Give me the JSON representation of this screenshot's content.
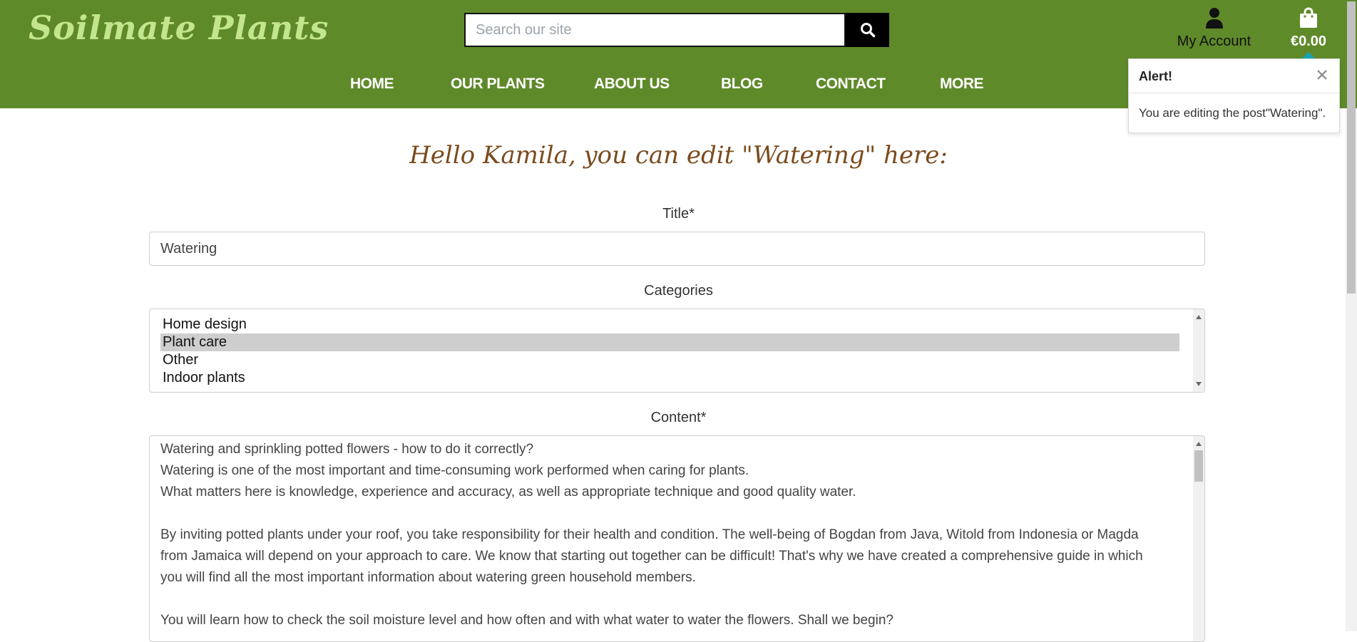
{
  "brand": {
    "logo": "Soilmate Plants"
  },
  "search": {
    "placeholder": "Search our site"
  },
  "account": {
    "label": "My Account"
  },
  "bag": {
    "total": "€0.00"
  },
  "nav": {
    "items": [
      {
        "label": "HOME"
      },
      {
        "label": "OUR PLANTS"
      },
      {
        "label": "ABOUT US"
      },
      {
        "label": "BLOG"
      },
      {
        "label": "CONTACT"
      },
      {
        "label": "MORE"
      }
    ]
  },
  "toast": {
    "title": "Alert!",
    "message": "You are editing the post\"Watering\"."
  },
  "form": {
    "heading": "Hello Kamila, you can edit \"Watering\" here:",
    "title_label": "Title*",
    "title_value": "Watering",
    "categories_label": "Categories",
    "categories": [
      {
        "label": "Home design",
        "selected": false
      },
      {
        "label": "Plant care",
        "selected": true
      },
      {
        "label": "Other",
        "selected": false
      },
      {
        "label": "Indoor plants",
        "selected": false
      }
    ],
    "content_label": "Content*",
    "content_lines": [
      "Watering and sprinkling potted flowers - how to do it correctly?",
      "Watering is one of the most important and time-consuming work performed when caring for plants.",
      "What matters here is knowledge, experience and accuracy, as well as appropriate technique and good quality water.",
      "",
      "By inviting potted plants under your roof, you take responsibility for their health and condition. The well-being of Bogdan from Java, Witold from Indonesia or Magda",
      "from Jamaica will depend on your approach to care. We know that starting out together can be difficult! That's why we have created a comprehensive guide in which",
      "you will find all the most important information about watering green household members.",
      "",
      "You will learn how to check the soil moisture level and how often and with what water to water the flowers. Shall we begin?"
    ]
  },
  "colors": {
    "header_bg": "#5f8a2a",
    "logo": "#c3e58d",
    "heading": "#7a4b1e",
    "toast_accent": "#17a2b8"
  },
  "icons": {
    "search": "search-icon",
    "account": "user-icon",
    "bag": "shopping-bag-icon",
    "close": "close-icon"
  }
}
